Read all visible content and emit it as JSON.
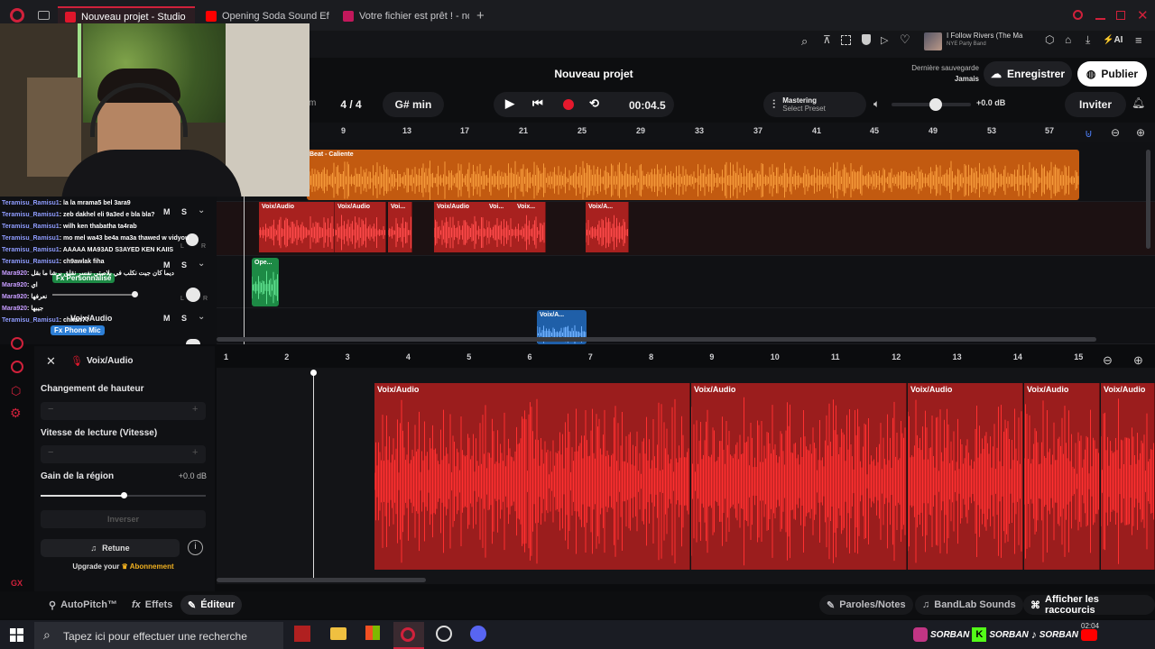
{
  "browser": {
    "tabs": [
      {
        "label": "Nouveau projet - Studio",
        "active": true,
        "icon_color": "#e0162b"
      },
      {
        "label": "Opening Soda Sound Effec",
        "active": false,
        "icon_color": "#ff0000"
      },
      {
        "label": "Votre fichier est prêt ! - no",
        "active": false,
        "icon_color": "#c2185b"
      }
    ],
    "new_tab": "+",
    "now_playing": {
      "title": "I Follow Rivers (The Ma",
      "artist": "NYE Party Band"
    },
    "ai_label": "AI"
  },
  "app": {
    "project_title": "Nouveau projet",
    "last_save_label": "Dernière sauvegarde",
    "last_save_value": "Jamais",
    "save_button": "Enregistrer",
    "publish_button": "Publier",
    "accent": "#d0213b"
  },
  "transport": {
    "partial_label": "m",
    "time_signature": "4 / 4",
    "key": "G# min",
    "time": "00:04.5",
    "mastering_title": "Mastering",
    "mastering_preset": "Select Preset",
    "volume_db": "+0.0 dB",
    "invite": "Inviter"
  },
  "ruler": [
    "9",
    "13",
    "17",
    "21",
    "25",
    "29",
    "33",
    "37",
    "41",
    "45",
    "49",
    "53",
    "57"
  ],
  "tracks": [
    {
      "name": "Beat - Caliente",
      "color": "#f07a1a",
      "clips": [
        "Beat - Caliente"
      ]
    },
    {
      "name": "Voix/Audio",
      "color": "#d42a2a",
      "clips": [
        "Voix/Audio",
        "Voix/Audio",
        "Voi...",
        "Voix/Audio",
        "Voi...",
        "Voix...",
        "Voix/A..."
      ]
    },
    {
      "name": "Voix/Audio",
      "color": "#27b35a",
      "clips": [
        "Ope..."
      ],
      "fx": "Fx Personnalisé"
    },
    {
      "name": "Voix/Audio",
      "color": "#2d7fd6",
      "clips": [
        "Voix/A..."
      ],
      "fx": "Fx Phone Mic"
    }
  ],
  "track_controls": {
    "mute": "M",
    "solo": "S",
    "left": "L",
    "right": "R"
  },
  "chat": [
    {
      "user": "Teramisu_Ramisu1",
      "msg": ": la la mrama5 bel 3ara9"
    },
    {
      "user": "Teramisu_Ramisu1",
      "msg": ": zeb dakhel eli 9a3ed e bla bla?"
    },
    {
      "user": "Teramisu_Ramisu1",
      "msg": ": wilh ken thabatha ta4rab"
    },
    {
      "user": "Teramisu_Ramisu1",
      "msg": ": mo mel wa43 be4a ma3a thawed w vidyou"
    },
    {
      "user": "Teramisu_Ramisu1",
      "msg": ": AAAAA MA93AD S3AYED KEN KAIIS"
    },
    {
      "user": "Teramisu_Ramisu1",
      "msg": ": ch9awlak fiha"
    },
    {
      "user": "Mara920",
      "msg": ": ديما كان جيت نكلب في بلاصتي نفسر نقلق برشا ما بقل"
    },
    {
      "user": "Mara920",
      "msg": ": اي"
    },
    {
      "user": "Mara920",
      "msg": ": نعرفها"
    },
    {
      "user": "Mara920",
      "msg": ": جيبها"
    },
    {
      "user": "Teramisu_Ramisu1",
      "msg": ": chkun??"
    }
  ],
  "editor": {
    "track_name": "Voix/Audio",
    "pitch_label": "Changement de hauteur",
    "speed_label": "Vitesse de lecture (Vitesse)",
    "gain_label": "Gain de la région",
    "gain_value": "+0.0 dB",
    "gain_level": 0.5,
    "reverse_button": "Inverser",
    "retune_button": "Retune",
    "upgrade_text": "Upgrade your",
    "upgrade_link": "Abonnement"
  },
  "bottom_ruler": [
    "1",
    "2",
    "3",
    "4",
    "5",
    "6",
    "7",
    "8",
    "9",
    "10",
    "11",
    "12",
    "13",
    "14",
    "15"
  ],
  "bottom_clips": [
    "Voix/Audio",
    "Voix/Audio",
    "Voix/Audio",
    "Voix/Audio",
    "Voix/Audio"
  ],
  "bottom_toolbar": {
    "autopitch": "AutoPitch™",
    "effects": "Effets",
    "editor": "Éditeur",
    "lyrics": "Paroles/Notes",
    "sounds": "BandLab Sounds",
    "shortcuts": "Afficher les raccourcis"
  },
  "taskbar": {
    "search_placeholder": "Tapez ici pour effectuer une recherche",
    "watermark": "SORBAN",
    "clock": "02:04"
  }
}
